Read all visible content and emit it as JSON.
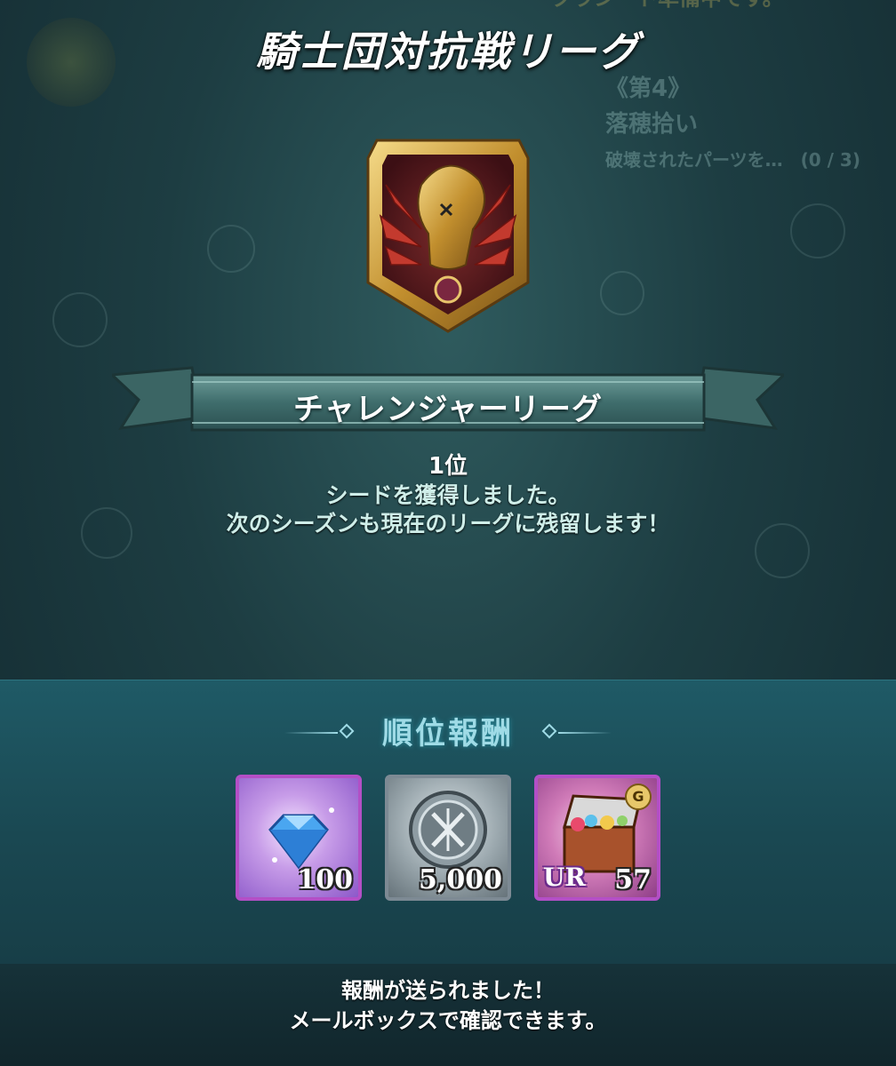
{
  "header": {
    "title": "騎士団対抗戦リーグ"
  },
  "background": {
    "ghost_top": "クラン一ト準備中です。",
    "ghost_lines": [
      "《第4》",
      "落穂拾い",
      "破壊されたパーツを…　(0 / 3)"
    ]
  },
  "league": {
    "crest_icon": "phoenix-crest-icon",
    "name": "チャレンジャーリーグ"
  },
  "result": {
    "rank": "1位",
    "line1": "シードを獲得しました。",
    "line2": "次のシーズンも現在のリーグに残留します！"
  },
  "rewards": {
    "heading": "順位報酬",
    "items": [
      {
        "icon": "crystal-gem-icon",
        "quantity": "100"
      },
      {
        "icon": "silver-medal-icon",
        "quantity": "5,000"
      },
      {
        "icon": "treasure-chest-icon",
        "quantity": "57",
        "rarity": "UR",
        "badge": "G"
      }
    ]
  },
  "footer": {
    "line1": "報酬が送られました！",
    "line2": "メールボックスで確認できます。"
  },
  "colors": {
    "accent_heading": "#9fdbe6",
    "frame_purple": "#b34fc6",
    "frame_silver": "#7d8a94"
  }
}
